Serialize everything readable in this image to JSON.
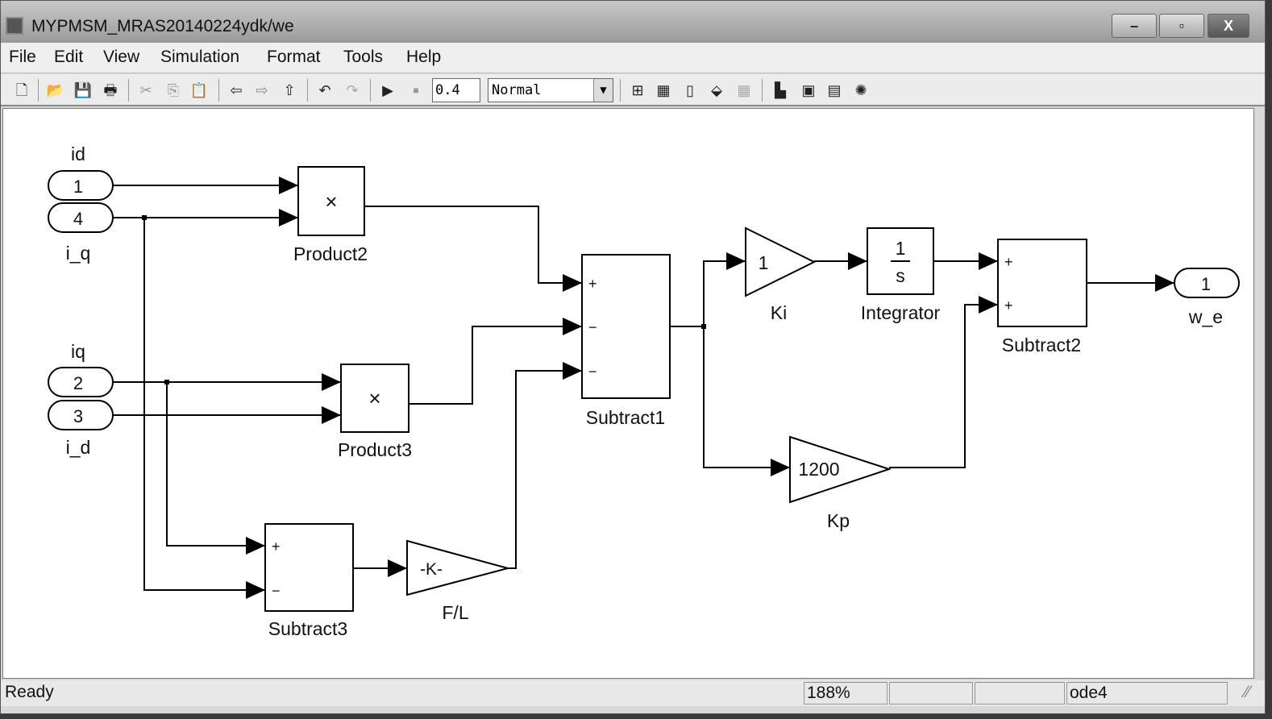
{
  "window": {
    "title": "MYPMSM_MRAS20140224ydk/we",
    "minimize": "–",
    "maximize": "▫",
    "close": "X"
  },
  "menu": [
    "File",
    "Edit",
    "View",
    "Simulation",
    "Format",
    "Tools",
    "Help"
  ],
  "toolbar": {
    "stop_time": "0.4",
    "sim_mode": "Normal",
    "icons": [
      "new-icon",
      "open-icon",
      "save-icon",
      "print-icon",
      "cut-icon",
      "copy-icon",
      "paste-icon",
      "back-icon",
      "forward-icon",
      "up-icon",
      "undo-icon",
      "redo-icon",
      "run-icon",
      "stop-icon",
      "library-browser-icon",
      "model-explorer-icon",
      "update-diagram-icon",
      "build-icon",
      "debug-icon",
      "model-advisor-icon",
      "editor-icon",
      "signal-builder-icon",
      "config-icon"
    ]
  },
  "diagram": {
    "inports": [
      {
        "num": "1",
        "label": "id"
      },
      {
        "num": "4",
        "label": "i_q"
      },
      {
        "num": "2",
        "label": "iq"
      },
      {
        "num": "3",
        "label": "i_d"
      }
    ],
    "outport": {
      "num": "1",
      "label": "w_e"
    },
    "product2": {
      "label": "Product2",
      "symbol": "×"
    },
    "product3": {
      "label": "Product3",
      "symbol": "×"
    },
    "subtract1": {
      "label": "Subtract1",
      "signs": [
        "+",
        "−",
        "−"
      ]
    },
    "subtract2": {
      "label": "Subtract2",
      "signs": [
        "+",
        "+"
      ]
    },
    "subtract3": {
      "label": "Subtract3",
      "signs": [
        "+",
        "−"
      ]
    },
    "ki": {
      "label": "Ki",
      "value": "1"
    },
    "kp": {
      "label": "Kp",
      "value": "1200"
    },
    "fl": {
      "label": "F/L",
      "value": "-K-"
    },
    "integrator": {
      "label": "Integrator",
      "num": "1",
      "den": "s"
    }
  },
  "status": {
    "text": "Ready",
    "zoom": "188%",
    "cell2": "",
    "cell3": "",
    "solver": "ode4"
  }
}
